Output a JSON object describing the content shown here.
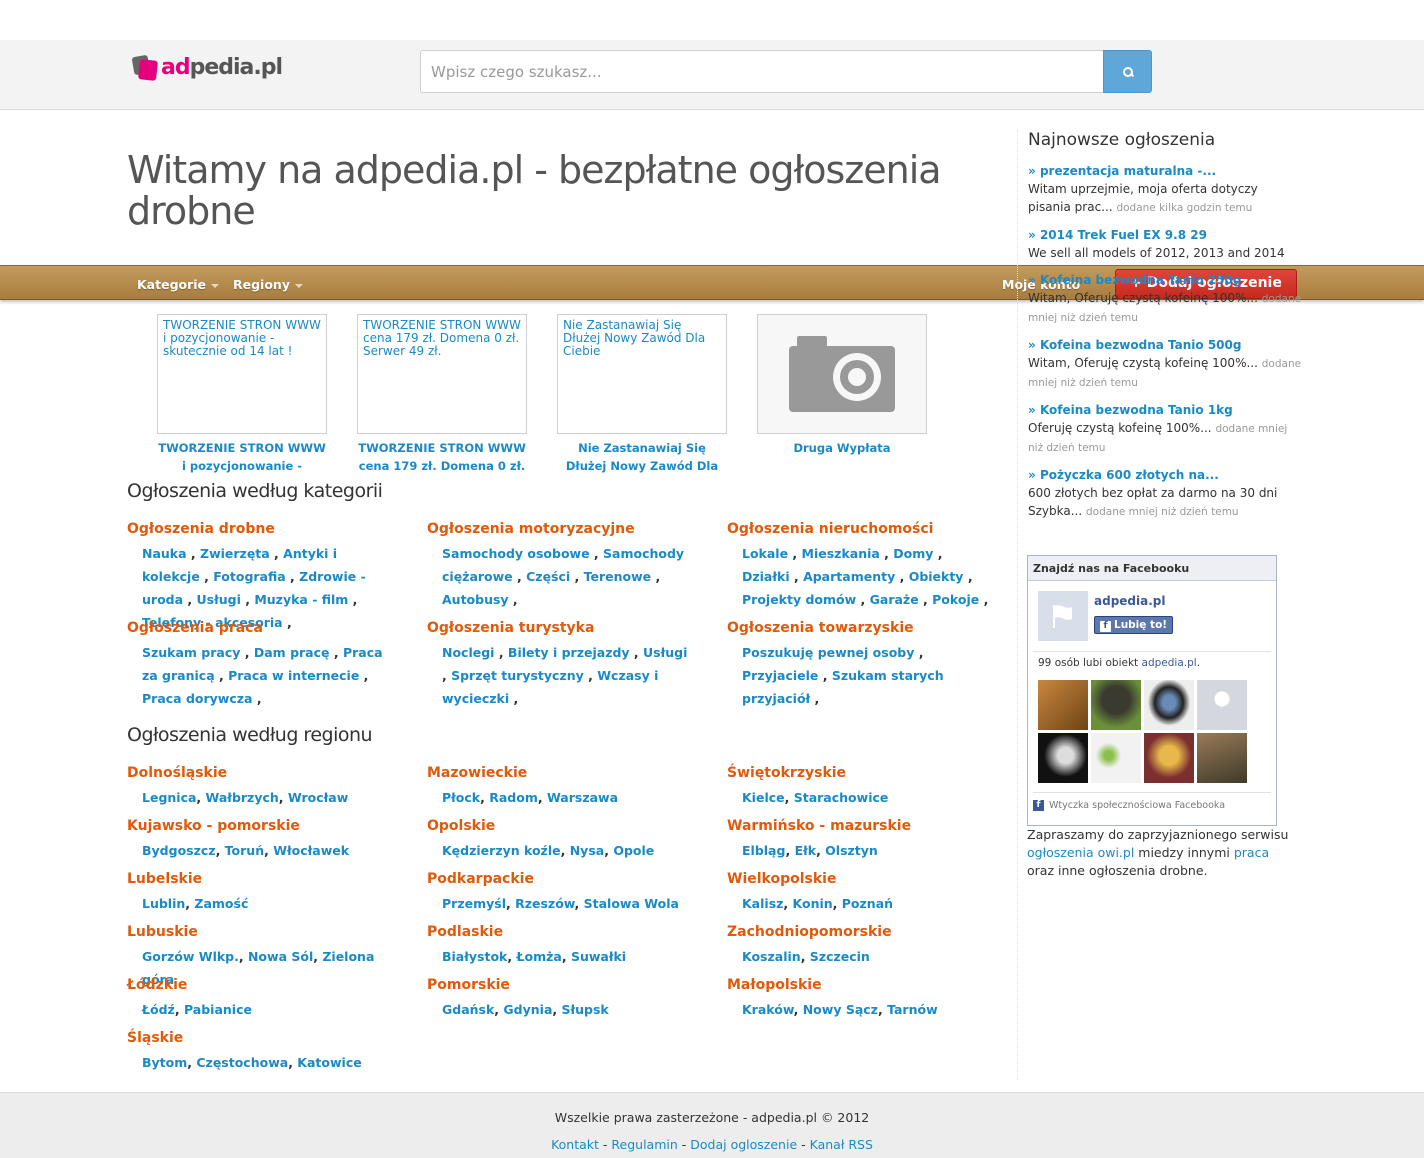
{
  "header": {
    "logo_text_main": "ad",
    "logo_text_rest": "pedia.pl",
    "search_placeholder": "Wpisz czego szukasz..."
  },
  "page_title": "Witamy na adpedia.pl - bezpłatne ogłoszenia drobne",
  "nav": {
    "kategorie": "Kategorie",
    "regiony": "Regiony",
    "moje_konto": "Moje konto",
    "add_button": "+ Dodaj ogłoszenie"
  },
  "featured": [
    {
      "box_text": "TWORZENIE STRON WWW i pozycjonowanie - skutecznie od 14 lat !",
      "caption": "TWORZENIE STRON WWW i pozycjonowanie - skutecznie"
    },
    {
      "box_text": "TWORZENIE STRON WWW cena 179 zł. Domena 0 zł. Serwer 49 zł.",
      "caption": "TWORZENIE STRON WWW cena 179 zł. Domena 0 zł."
    },
    {
      "box_text": "Nie Zastanawiaj Się Dłużej Nowy Zawód Dla Ciebie",
      "caption": "Nie Zastanawiaj Się Dłużej Nowy Zawód Dla Ciebie"
    },
    {
      "box_text": "",
      "caption": "Druga Wypłata"
    }
  ],
  "categories_heading": "Ogłoszenia według kategorii",
  "categories": [
    {
      "title": "Ogłoszenia drobne",
      "links": [
        "Nauka",
        "Zwierzęta",
        "Antyki i kolekcje",
        "Fotografia",
        "Zdrowie - uroda",
        "Usługi",
        "Muzyka - film",
        "Telefony - akcesoria"
      ]
    },
    {
      "title": "Ogłoszenia motoryzacyjne",
      "links": [
        "Samochody osobowe",
        "Samochody ciężarowe",
        "Części",
        "Terenowe",
        "Autobusy"
      ]
    },
    {
      "title": "Ogłoszenia nieruchomości",
      "links": [
        "Lokale",
        "Mieszkania",
        "Domy",
        "Działki",
        "Apartamenty",
        "Obiekty",
        "Projekty domów",
        "Garaże",
        "Pokoje"
      ]
    },
    {
      "title": "Ogłoszenia praca",
      "links": [
        "Szukam pracy",
        "Dam pracę",
        "Praca za granicą",
        "Praca w internecie",
        "Praca dorywcza"
      ]
    },
    {
      "title": "Ogłoszenia turystyka",
      "links": [
        "Noclegi",
        "Bilety i przejazdy",
        "Usługi",
        "Sprzęt turystyczny",
        "Wczasy i wycieczki"
      ]
    },
    {
      "title": "Ogłoszenia towarzyskie",
      "links": [
        "Poszukuję pewnej osoby",
        "Przyjaciele",
        "Szukam starych przyjaciół"
      ]
    }
  ],
  "regions_heading": "Ogłoszenia według regionu",
  "regions": [
    {
      "title": "Dolnośląskie",
      "links": [
        "Legnica",
        "Wałbrzych",
        "Wrocław"
      ]
    },
    {
      "title": "Mazowieckie",
      "links": [
        "Płock",
        "Radom",
        "Warszawa"
      ]
    },
    {
      "title": "Świętokrzyskie",
      "links": [
        "Kielce",
        "Starachowice"
      ]
    },
    {
      "title": "Kujawsko - pomorskie",
      "links": [
        "Bydgoszcz",
        "Toruń",
        "Włocławek"
      ]
    },
    {
      "title": "Opolskie",
      "links": [
        "Kędzierzyn koźle",
        "Nysa",
        "Opole"
      ]
    },
    {
      "title": "Warmińsko - mazurskie",
      "links": [
        "Elbląg",
        "Ełk",
        "Olsztyn"
      ]
    },
    {
      "title": "Lubelskie",
      "links": [
        "Lublin",
        "Zamość"
      ]
    },
    {
      "title": "Podkarpackie",
      "links": [
        "Przemyśl",
        "Rzeszów",
        "Stalowa Wola"
      ]
    },
    {
      "title": "Wielkopolskie",
      "links": [
        "Kalisz",
        "Konin",
        "Poznań"
      ]
    },
    {
      "title": "Lubuskie",
      "links": [
        "Gorzów Wlkp.",
        "Nowa Sól",
        "Zielona góra"
      ]
    },
    {
      "title": "Podlaskie",
      "links": [
        "Białystok",
        "Łomża",
        "Suwałki"
      ]
    },
    {
      "title": "Zachodniopomorskie",
      "links": [
        "Koszalin",
        "Szczecin"
      ]
    },
    {
      "title": "Łódzkie",
      "links": [
        "Łódź",
        "Pabianice"
      ]
    },
    {
      "title": "Pomorskie",
      "links": [
        "Gdańsk",
        "Gdynia",
        "Słupsk"
      ]
    },
    {
      "title": "Małopolskie",
      "links": [
        "Kraków",
        "Nowy Sącz",
        "Tarnów"
      ]
    },
    {
      "title": "Śląskie",
      "links": [
        "Bytom",
        "Częstochowa",
        "Katowice"
      ]
    }
  ],
  "sidebar": {
    "heading": "Najnowsze ogłoszenia",
    "items": [
      {
        "title": "prezentacja maturalna -...",
        "text": "Witam uprzejmie, moja oferta dotyczy pisania prac...",
        "meta": "dodane kilka godzin temu"
      },
      {
        "title": "2014 Trek Fuel EX 9.8 29",
        "text": "We sell all models of 2012, 2013 and 2014",
        "meta": ""
      },
      {
        "title": "Kofeina bezwodna Tanio 250g",
        "text": "Witam, Oferuję czystą kofeinę 100%...",
        "meta": "dodane mniej niż dzień temu"
      },
      {
        "title": "Kofeina bezwodna Tanio 500g",
        "text": "Witam, Oferuję czystą kofeinę 100%...",
        "meta": "dodane mniej niż dzień temu"
      },
      {
        "title": "Kofeina bezwodna Tanio 1kg",
        "text": "Oferuję czystą kofeinę 100%...",
        "meta": "dodane mniej niż dzień temu"
      },
      {
        "title": "Pożyczka 600 złotych na...",
        "text": "600 złotych bez opłat za darmo na 30 dni Szybka...",
        "meta": "dodane mniej niż dzień temu"
      }
    ],
    "facebook": {
      "header": "Znajdź nas na Facebooku",
      "page_name": "adpedia.pl",
      "like_button": "Lubię to!",
      "count_prefix": "99 osób lubi obiekt ",
      "count_link": "adpedia.pl",
      "count_suffix": ".",
      "footer": "Wtyczka społecznościowa Facebooka"
    },
    "note_1": "Zapraszamy do zaprzyjaznionego serwisu ",
    "note_link_1": "ogłoszenia owi.pl",
    "note_2": " miedzy innymi ",
    "note_link_2": "praca",
    "note_3": " oraz inne ogłoszenia drobne."
  },
  "footer": {
    "copyright": "Wszelkie prawa zasterzeżone - adpedia.pl © 2012",
    "links": [
      "Kontakt",
      "Regulamin",
      "Dodaj ogloszenie",
      "Kanał RSS"
    ],
    "separator": " - "
  },
  "colors": {
    "brand": "#e6007e",
    "link": "#1a8ac6",
    "category": "#e05a0c",
    "navbar": "#b58a4c",
    "add_button": "#d3362b",
    "search_button": "#5fa7d8"
  },
  "icons": [
    "search-icon",
    "caret-down-icon",
    "camera-icon",
    "facebook-icon"
  ]
}
